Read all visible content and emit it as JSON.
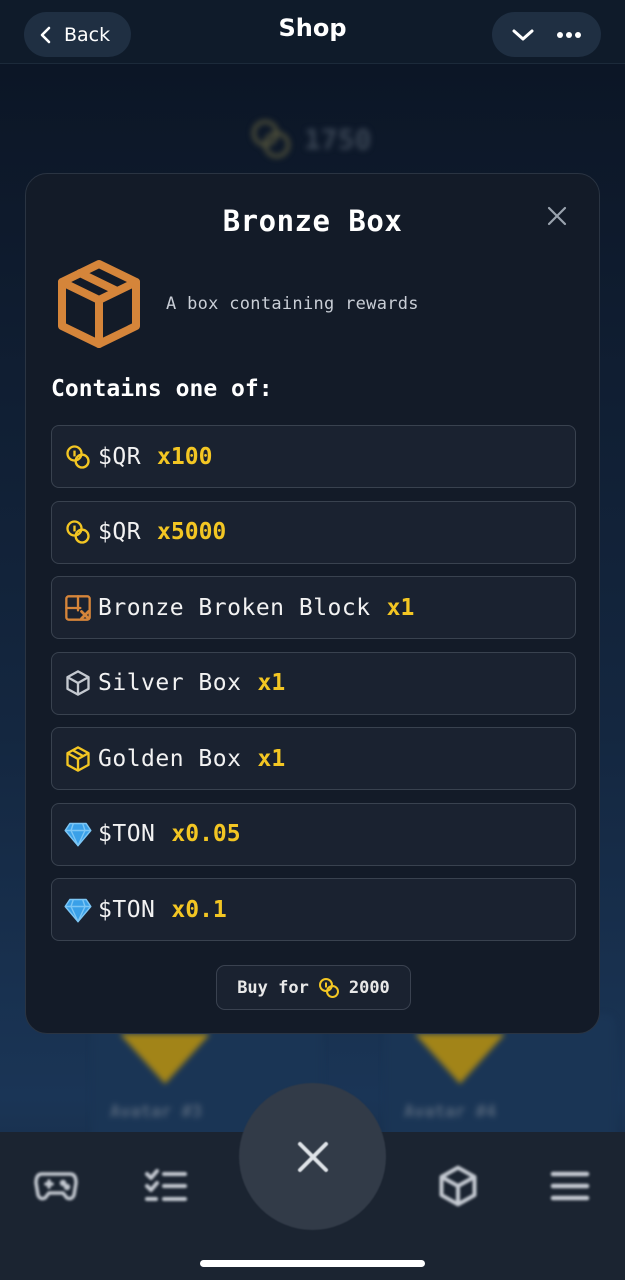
{
  "header": {
    "back_label": "Back",
    "title": "Shop"
  },
  "background": {
    "balance": "1750",
    "avatars": [
      "Avatar #3",
      "Avatar #4"
    ]
  },
  "modal": {
    "title": "Bronze Box",
    "description": "A box containing rewards",
    "contains_heading": "Contains one of:",
    "rewards": [
      {
        "icon": "coins-icon",
        "name": "$QR",
        "qty": "x100"
      },
      {
        "icon": "coins-icon",
        "name": "$QR",
        "qty": "x5000"
      },
      {
        "icon": "broken-block-icon",
        "name": "Bronze Broken Block",
        "qty": "x1"
      },
      {
        "icon": "silver-box-icon",
        "name": "Silver Box",
        "qty": "x1"
      },
      {
        "icon": "golden-box-icon",
        "name": "Golden Box",
        "qty": "x1"
      },
      {
        "icon": "diamond-icon",
        "name": "$TON",
        "qty": "x0.05"
      },
      {
        "icon": "diamond-icon",
        "name": "$TON",
        "qty": "x0.1"
      }
    ],
    "buy_label": "Buy for",
    "price": "2000"
  },
  "nav": {
    "items": [
      "gamepad-icon",
      "checklist-icon",
      "close-icon",
      "box-icon",
      "menu-icon"
    ]
  },
  "colors": {
    "accent_gold": "#f3c623",
    "bronze": "#d5853a",
    "diamond": "#3aa0e8",
    "modal_bg": "#131b28"
  }
}
